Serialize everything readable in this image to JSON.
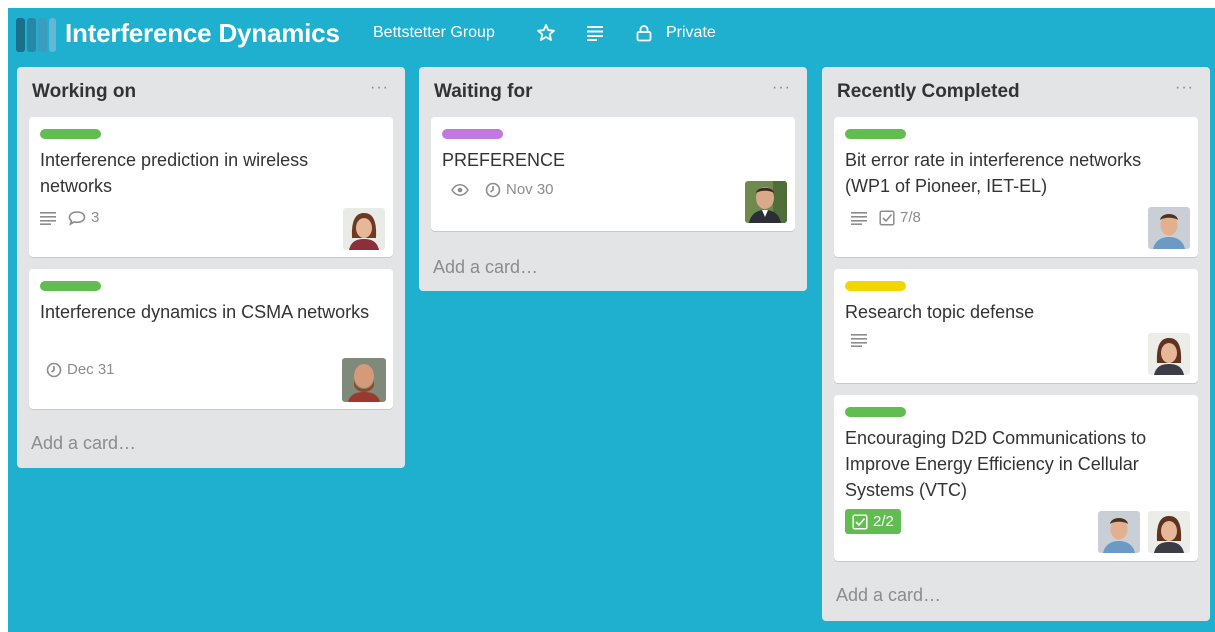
{
  "header": {
    "title": "Interference Dynamics",
    "team": "Bettstetter Group",
    "visibility": "Private",
    "icons": [
      "board-logo-icon",
      "star-icon",
      "menu-lines-icon",
      "lock-icon"
    ]
  },
  "lists": [
    {
      "title": "Working on",
      "menu": "···",
      "add_card": "Add a card…",
      "cards": [
        {
          "label_color": "#61bd4f",
          "title": "Interference prediction in wireless networks",
          "badges": {
            "description": true,
            "comments": "3"
          },
          "members": [
            "woman"
          ]
        },
        {
          "label_color": "#61bd4f",
          "title": "Interference dynamics in CSMA networks",
          "badges": {
            "due": "Dec 31"
          },
          "members": [
            "bearded-man"
          ]
        }
      ]
    },
    {
      "title": "Waiting for",
      "menu": "···",
      "add_card": "Add a card…",
      "cards": [
        {
          "label_color": "#c377e0",
          "title": "PREFERENCE",
          "badges": {
            "watching": true,
            "due": "Nov 30"
          },
          "members": [
            "man-suit"
          ]
        }
      ]
    },
    {
      "title": "Recently Completed",
      "menu": "···",
      "add_card": "Add a card…",
      "cards": [
        {
          "label_color": "#61bd4f",
          "title": "Bit error rate in interference networks (WP1 of Pioneer, IET-EL)",
          "badges": {
            "description": true,
            "checklist": "7/8"
          },
          "members": [
            "man"
          ]
        },
        {
          "label_color": "#f2d600",
          "title": "Research topic defense",
          "badges": {
            "description": true
          },
          "members": [
            "woman"
          ]
        },
        {
          "label_color": "#61bd4f",
          "title": "Encouraging D2D Communications to Improve Energy Efficiency in Cellular Systems (VTC)",
          "badges": {
            "checklist_complete": "2/2"
          },
          "members": [
            "man",
            "woman"
          ]
        }
      ]
    }
  ]
}
